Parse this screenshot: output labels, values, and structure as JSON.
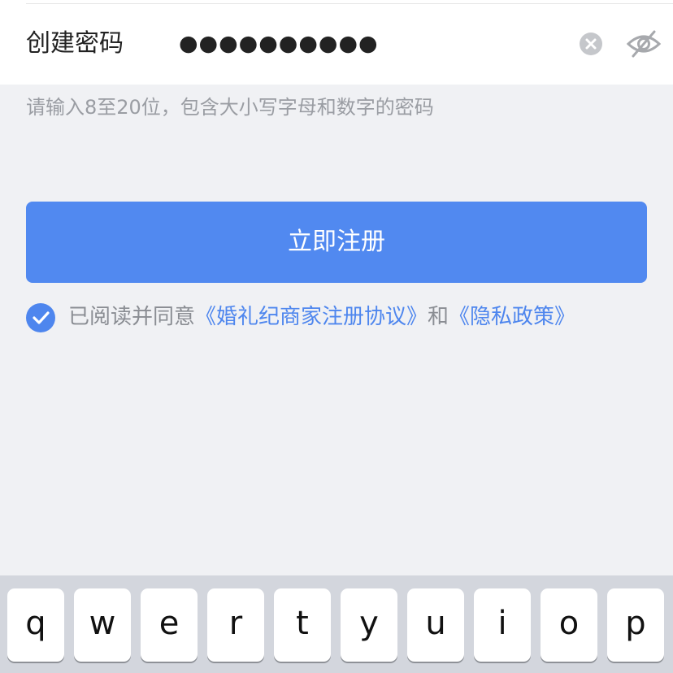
{
  "password_field": {
    "label": "创建密码",
    "value": "●●●●●●●●●●",
    "clear_icon": "clear-circle-icon",
    "visibility_icon": "eye-slash-icon"
  },
  "hint": "请输入8至20位，包含大小写字母和数字的密码",
  "register_button": "立即注册",
  "agreement": {
    "checked": true,
    "prefix": "已阅读并同意",
    "link1": "《婚礼纪商家注册协议》",
    "middle": "和",
    "link2": "《隐私政策》"
  },
  "keyboard": {
    "keys": [
      "q",
      "w",
      "e",
      "r",
      "t",
      "y",
      "u",
      "i",
      "o",
      "p"
    ]
  },
  "colors": {
    "accent": "#5189f0",
    "link": "#4e86ee",
    "background": "#f0f1f4",
    "hint": "#9a9da3"
  }
}
